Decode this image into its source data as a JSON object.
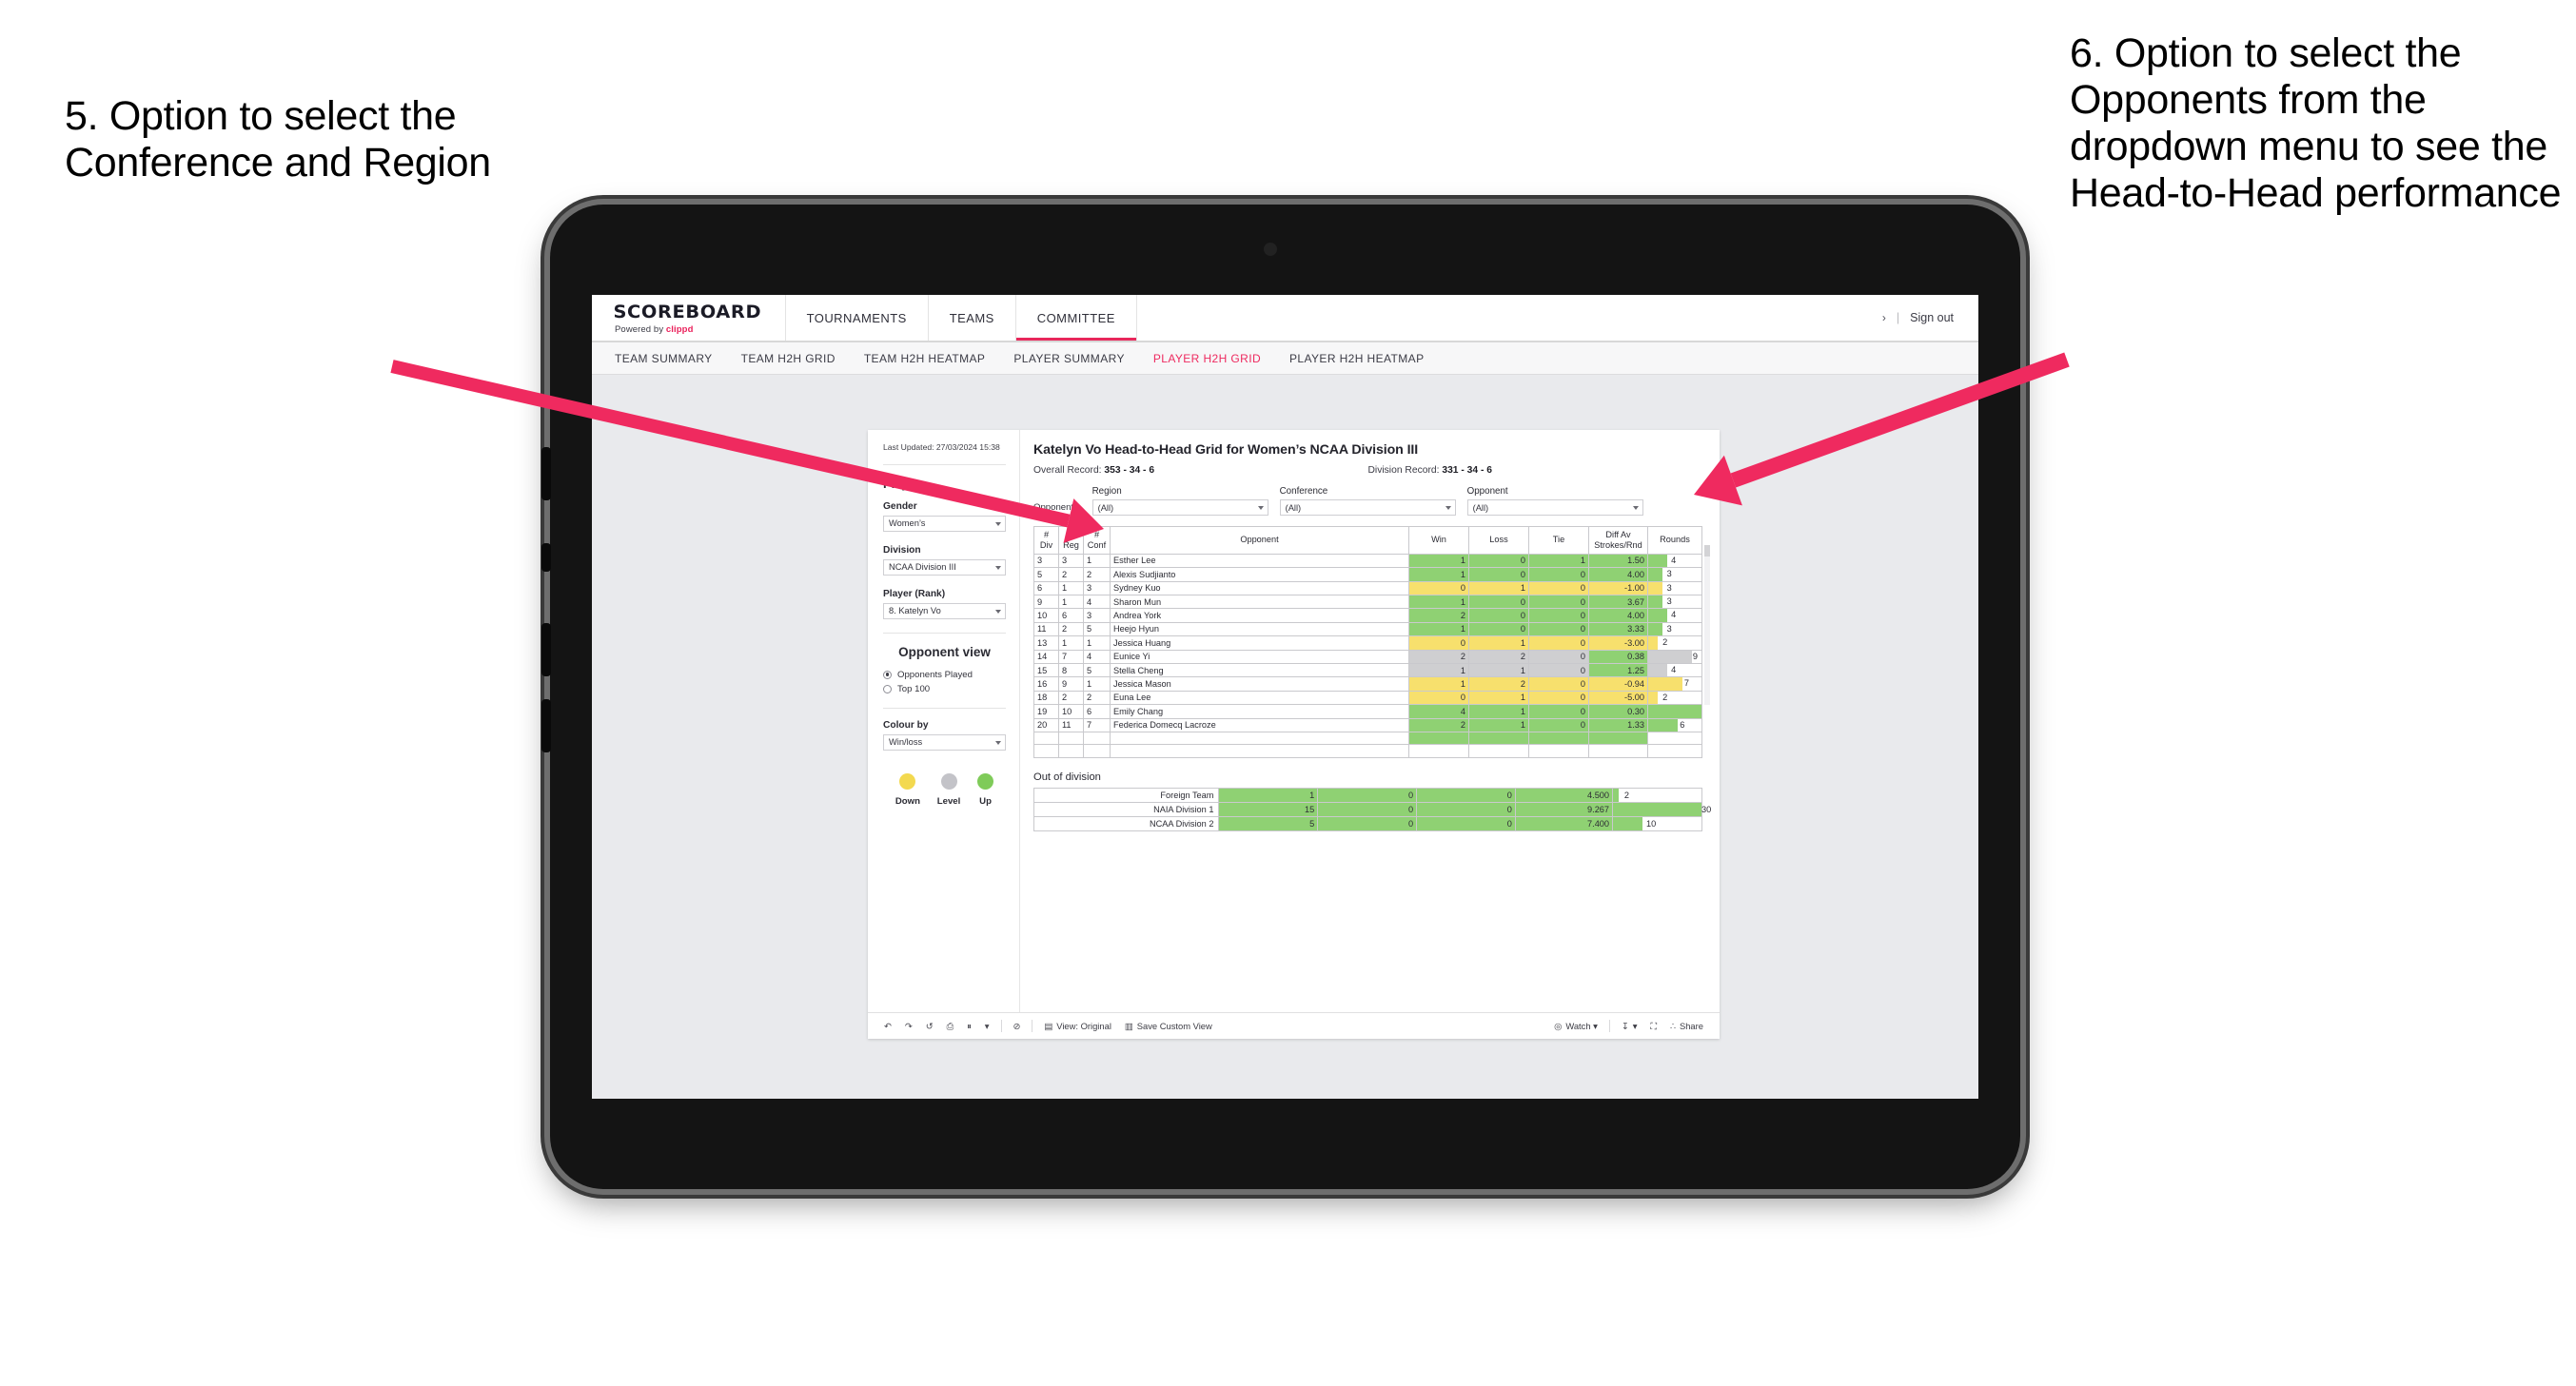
{
  "annotations": {
    "left": "5. Option to select the Conference and Region",
    "right": "6. Option to select the Opponents from the dropdown menu to see the Head-to-Head performance",
    "arrow_color": "#ef2a5f"
  },
  "app": {
    "brand": {
      "name": "SCOREBOARD",
      "powered_prefix": "Powered by ",
      "powered_brand": "clippd"
    },
    "topnav": [
      {
        "label": "TOURNAMENTS",
        "active": false
      },
      {
        "label": "TEAMS",
        "active": false
      },
      {
        "label": "COMMITTEE",
        "active": true
      }
    ],
    "account": {
      "chevron": "›",
      "separator": "|",
      "sign_out": "Sign out"
    },
    "subnav": [
      {
        "label": "TEAM SUMMARY",
        "active": false
      },
      {
        "label": "TEAM H2H GRID",
        "active": false
      },
      {
        "label": "TEAM H2H HEATMAP",
        "active": false
      },
      {
        "label": "PLAYER SUMMARY",
        "active": false
      },
      {
        "label": "PLAYER H2H GRID",
        "active": true
      },
      {
        "label": "PLAYER H2H HEATMAP",
        "active": false
      }
    ]
  },
  "sidebar": {
    "last_updated": "Last Updated: 27/03/2024 15:38",
    "player_heading": "Player",
    "gender": {
      "label": "Gender",
      "value": "Women’s"
    },
    "division": {
      "label": "Division",
      "value": "NCAA Division III"
    },
    "player_rank": {
      "label": "Player (Rank)",
      "value": "8. Katelyn Vo"
    },
    "opponent_view": {
      "heading": "Opponent view",
      "options": [
        {
          "label": "Opponents Played",
          "selected": true
        },
        {
          "label": "Top 100",
          "selected": false
        }
      ]
    },
    "colour_by": {
      "label": "Colour by",
      "value": "Win/loss"
    },
    "legend": [
      {
        "caption": "Down",
        "color": "#f3d94f"
      },
      {
        "caption": "Level",
        "color": "#c3c3c8"
      },
      {
        "caption": "Up",
        "color": "#7fcb59"
      }
    ]
  },
  "main": {
    "title": "Katelyn Vo Head-to-Head Grid for Women’s NCAA Division III",
    "overall_record_label": "Overall Record:",
    "overall_record_value": "353 - 34 - 6",
    "division_record_label": "Division Record:",
    "division_record_value": "331 - 34 - 6",
    "opponents_label": "Opponents:",
    "filters": [
      {
        "label": "Region",
        "value": "(All)"
      },
      {
        "label": "Conference",
        "value": "(All)"
      },
      {
        "label": "Opponent",
        "value": "(All)"
      }
    ],
    "out_of_division_title": "Out of division"
  },
  "chart_data": {
    "type": "table",
    "title": "Katelyn Vo Head-to-Head Grid for Women’s NCAA Division III",
    "columns": [
      "# Div",
      "# Reg",
      "# Conf",
      "Opponent",
      "Win",
      "Loss",
      "Tie",
      "Diff Av Strokes/Rnd",
      "Rounds"
    ],
    "column_header_lines": [
      [
        "#",
        "Div"
      ],
      [
        "#",
        "Reg"
      ],
      [
        "#",
        "Conf"
      ],
      [
        "Opponent"
      ],
      [
        "Win"
      ],
      [
        "Loss"
      ],
      [
        "Tie"
      ],
      [
        "Diff Av",
        "Strokes/Rnd"
      ],
      [
        "Rounds"
      ]
    ],
    "rounds_max": 11,
    "rows": [
      {
        "div": "3",
        "reg": "3",
        "conf": "1",
        "opponent": "Esther Lee",
        "win": "1",
        "loss": "0",
        "tie": "1",
        "diff": "1.50",
        "rounds": "4",
        "state": "up"
      },
      {
        "div": "5",
        "reg": "2",
        "conf": "2",
        "opponent": "Alexis Sudjianto",
        "win": "1",
        "loss": "0",
        "tie": "0",
        "diff": "4.00",
        "rounds": "3",
        "state": "up"
      },
      {
        "div": "6",
        "reg": "1",
        "conf": "3",
        "opponent": "Sydney Kuo",
        "win": "0",
        "loss": "1",
        "tie": "0",
        "diff": "-1.00",
        "rounds": "3",
        "state": "down"
      },
      {
        "div": "9",
        "reg": "1",
        "conf": "4",
        "opponent": "Sharon Mun",
        "win": "1",
        "loss": "0",
        "tie": "0",
        "diff": "3.67",
        "rounds": "3",
        "state": "up"
      },
      {
        "div": "10",
        "reg": "6",
        "conf": "3",
        "opponent": "Andrea York",
        "win": "2",
        "loss": "0",
        "tie": "0",
        "diff": "4.00",
        "rounds": "4",
        "state": "up"
      },
      {
        "div": "11",
        "reg": "2",
        "conf": "5",
        "opponent": "Heejo Hyun",
        "win": "1",
        "loss": "0",
        "tie": "0",
        "diff": "3.33",
        "rounds": "3",
        "state": "up"
      },
      {
        "div": "13",
        "reg": "1",
        "conf": "1",
        "opponent": "Jessica Huang",
        "win": "0",
        "loss": "1",
        "tie": "0",
        "diff": "-3.00",
        "rounds": "2",
        "state": "down"
      },
      {
        "div": "14",
        "reg": "7",
        "conf": "4",
        "opponent": "Eunice Yi",
        "win": "2",
        "loss": "2",
        "tie": "0",
        "diff": "0.38",
        "rounds": "9",
        "state": "level",
        "diff_state": "up"
      },
      {
        "div": "15",
        "reg": "8",
        "conf": "5",
        "opponent": "Stella Cheng",
        "win": "1",
        "loss": "1",
        "tie": "0",
        "diff": "1.25",
        "rounds": "4",
        "state": "level",
        "diff_state": "up"
      },
      {
        "div": "16",
        "reg": "9",
        "conf": "1",
        "opponent": "Jessica Mason",
        "win": "1",
        "loss": "2",
        "tie": "0",
        "diff": "-0.94",
        "rounds": "7",
        "state": "down"
      },
      {
        "div": "18",
        "reg": "2",
        "conf": "2",
        "opponent": "Euna Lee",
        "win": "0",
        "loss": "1",
        "tie": "0",
        "diff": "-5.00",
        "rounds": "2",
        "state": "down"
      },
      {
        "div": "19",
        "reg": "10",
        "conf": "6",
        "opponent": "Emily Chang",
        "win": "4",
        "loss": "1",
        "tie": "0",
        "diff": "0.30",
        "rounds": "11",
        "state": "up"
      },
      {
        "div": "20",
        "reg": "11",
        "conf": "7",
        "opponent": "Federica Domecq Lacroze",
        "win": "2",
        "loss": "1",
        "tie": "0",
        "diff": "1.33",
        "rounds": "6",
        "state": "up"
      }
    ],
    "out_of_division": {
      "rounds_max": 30,
      "rows": [
        {
          "label": "Foreign Team",
          "win": "1",
          "loss": "0",
          "tie": "0",
          "diff": "4.500",
          "rounds": "2",
          "state": "up"
        },
        {
          "label": "NAIA Division 1",
          "win": "15",
          "loss": "0",
          "tie": "0",
          "diff": "9.267",
          "rounds": "30",
          "state": "up"
        },
        {
          "label": "NCAA Division 2",
          "win": "5",
          "loss": "0",
          "tie": "0",
          "diff": "7.400",
          "rounds": "10",
          "state": "up"
        }
      ]
    },
    "colors": {
      "up": "#8fd173",
      "down": "#f7e06d",
      "level": "#cfcfd1"
    }
  },
  "toolbar": {
    "items": [
      {
        "name": "undo",
        "icon": "↶",
        "label": ""
      },
      {
        "name": "redo",
        "icon": "↷",
        "label": ""
      },
      {
        "name": "revert",
        "icon": "↺",
        "label": ""
      },
      {
        "name": "refresh",
        "icon": "⎙",
        "label": ""
      },
      {
        "name": "pause",
        "icon": "⏸",
        "label": ""
      },
      {
        "name": "dropdown",
        "icon": "▾",
        "label": ""
      },
      {
        "name": "alerts",
        "icon": "⊘",
        "label": ""
      },
      {
        "name": "view",
        "icon": "▤",
        "label": "View: Original"
      },
      {
        "name": "save-view",
        "icon": "▥",
        "label": "Save Custom View"
      },
      {
        "name": "watch",
        "icon": "◎",
        "label": "Watch ▾"
      },
      {
        "name": "download",
        "icon": "↧",
        "label": "▾"
      },
      {
        "name": "fullscreen",
        "icon": "⛶",
        "label": ""
      },
      {
        "name": "share",
        "icon": "∴",
        "label": "Share"
      }
    ]
  }
}
